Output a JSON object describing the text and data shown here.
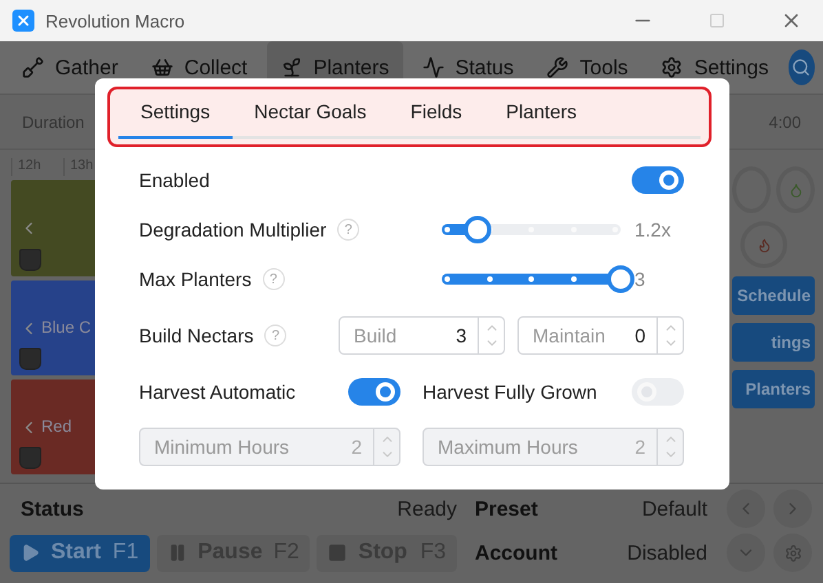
{
  "window": {
    "title": "Revolution Macro"
  },
  "nav": {
    "tabs": [
      {
        "label": "Gather",
        "selected": false
      },
      {
        "label": "Collect",
        "selected": false
      },
      {
        "label": "Planters",
        "selected": true
      },
      {
        "label": "Status",
        "selected": false
      },
      {
        "label": "Tools",
        "selected": false
      },
      {
        "label": "Settings",
        "selected": false
      }
    ]
  },
  "toolbar": {
    "duration_label": "Duration",
    "time": "4:00"
  },
  "timeline": {
    "hours": [
      "12h",
      "13h"
    ],
    "planters": [
      {
        "color": "#444a22"
      },
      {
        "label": "Blue C",
        "color": "#26428a"
      },
      {
        "label": "Red",
        "color": "#6a2a24"
      }
    ]
  },
  "side_buttons": [
    "Schedule",
    "tings",
    "Planters"
  ],
  "dialog": {
    "tabs": [
      {
        "label": "Settings",
        "selected": true
      },
      {
        "label": "Nectar Goals",
        "selected": false
      },
      {
        "label": "Fields",
        "selected": false
      },
      {
        "label": "Planters",
        "selected": false
      }
    ],
    "rows": [
      {
        "kind": "toggle",
        "label": "Enabled",
        "on": true
      },
      {
        "kind": "slider",
        "label": "Degradation Multiplier",
        "help": "?",
        "level": 0.2,
        "reading": "1.2x"
      },
      {
        "kind": "slider",
        "label": "Max Planters",
        "help": "?",
        "level": 1,
        "reading": "3"
      },
      {
        "kind": "numbers",
        "label": "Build Nectars",
        "help": "?",
        "fields": [
          {
            "label": "Build",
            "value": "3",
            "disabled": false
          },
          {
            "label": "Maintain",
            "value": "0",
            "disabled": false
          }
        ]
      },
      {
        "kind": "toggles",
        "items": [
          {
            "label": "Harvest Automatic",
            "on": true
          },
          {
            "label": "Harvest Fully Grown",
            "on": false
          }
        ]
      },
      {
        "kind": "fields",
        "fields": [
          {
            "label": "Minimum Hours",
            "value": "2",
            "disabled": true
          },
          {
            "label": "Maximum Hours",
            "value": "2",
            "disabled": true
          }
        ]
      }
    ]
  },
  "status": {
    "label": "Status",
    "value": "Ready"
  },
  "preset": {
    "label": "Preset",
    "value": "Default"
  },
  "account": {
    "label": "Account",
    "value": "Disabled"
  },
  "controls": [
    {
      "kind": "start",
      "label": "Start",
      "key": "F1"
    },
    {
      "kind": "pause",
      "label": "Pause",
      "key": "F2"
    },
    {
      "kind": "stop",
      "label": "Stop",
      "key": "F3"
    }
  ]
}
